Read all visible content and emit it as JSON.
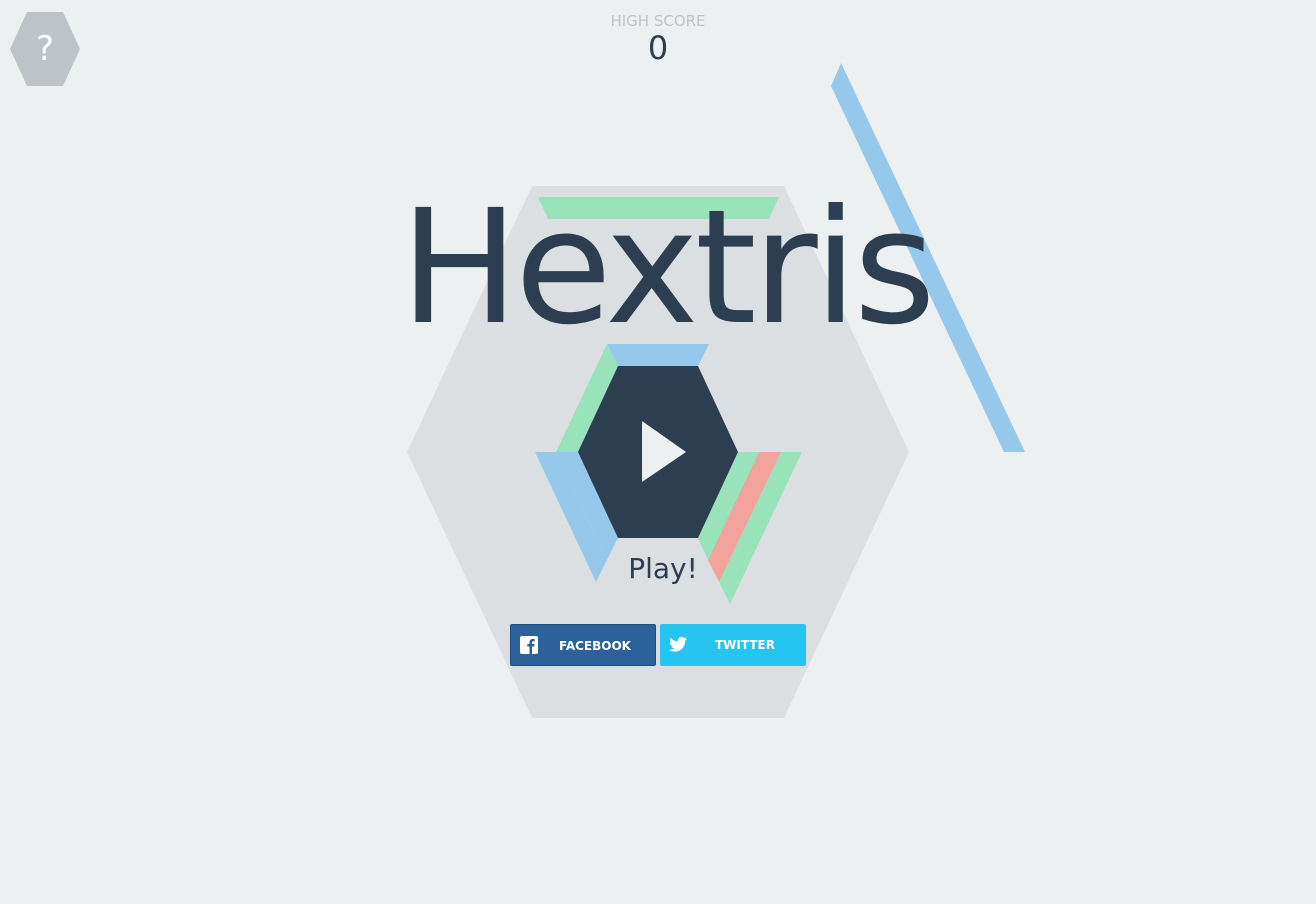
{
  "help": {
    "glyph": "?",
    "icon": "help-hexagon-icon"
  },
  "high_score": {
    "label": "HIGH SCORE",
    "value": "0"
  },
  "title": "Hextris",
  "play": {
    "label": "Play!",
    "icon": "play-icon"
  },
  "share": {
    "facebook_label": "FACEBOOK",
    "twitter_label": "TWITTER",
    "facebook_icon": "facebook-icon",
    "twitter_icon": "twitter-icon"
  },
  "colors": {
    "background": "#ecf0f1",
    "board": "#dcdfe2",
    "hexagon_dark": "#2c3e50",
    "help_gray": "#bdc3c7",
    "block_blue": "#96c8eb",
    "block_green": "#98e3b9",
    "block_red": "#f2a39b",
    "facebook": "#2d6199",
    "twitter": "#26c4f0"
  }
}
